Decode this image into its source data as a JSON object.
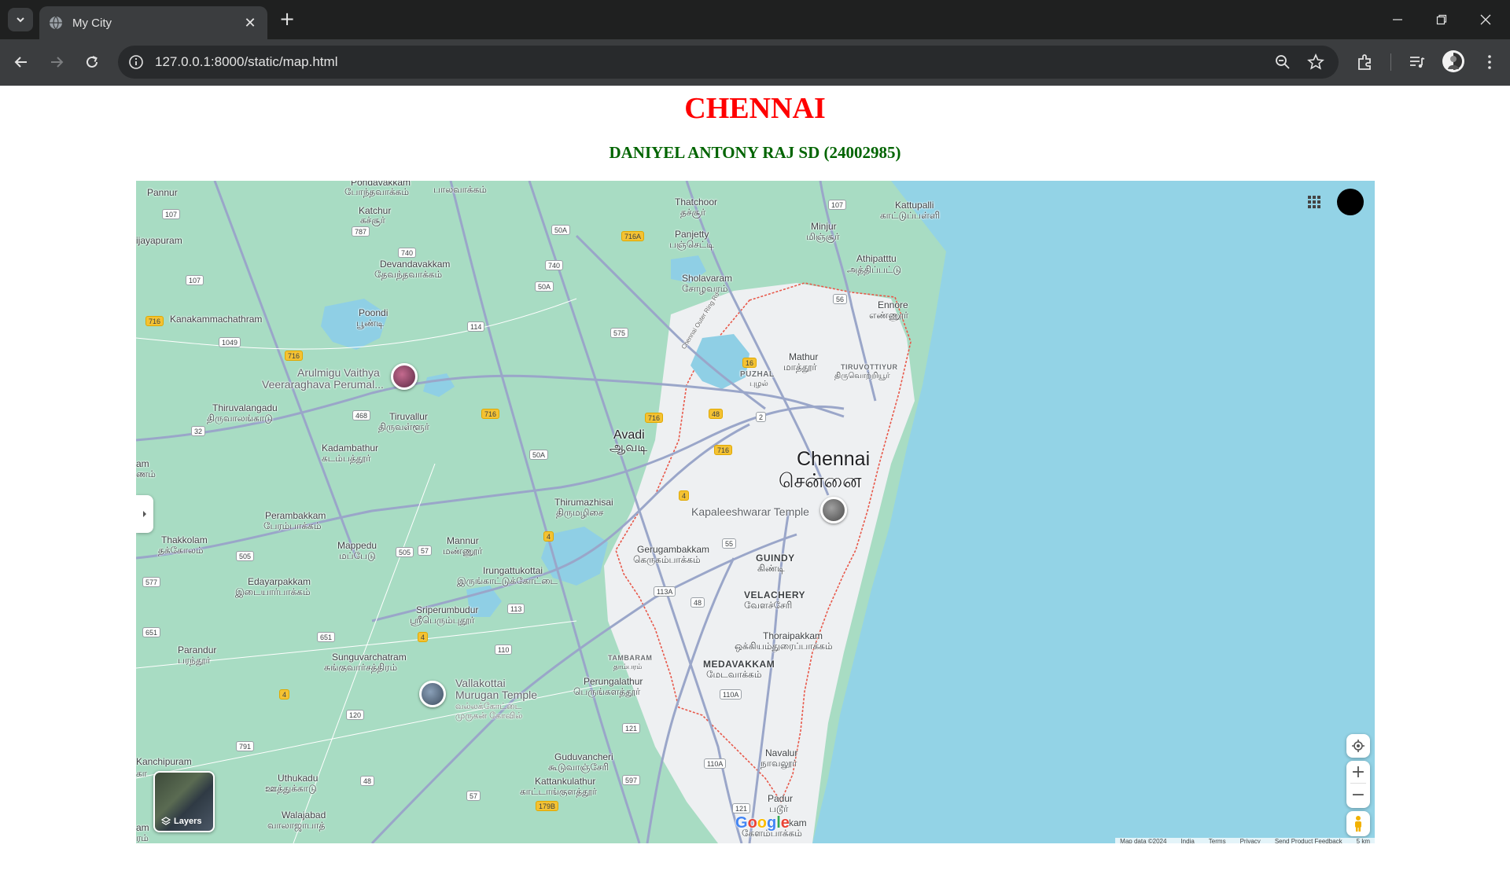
{
  "browser": {
    "tab_title": "My City",
    "url": "127.0.0.1:8000/static/map.html"
  },
  "page": {
    "title": "CHENNAI",
    "subtitle": "DANIYEL ANTONY RAJ SD (24002985)"
  },
  "map": {
    "labels": {
      "chennai": "Chennai",
      "chennai_ta": "சென்னை",
      "avadi": "Avadi",
      "avadi_ta": "ஆவடி",
      "kapaleeshwarar": "Kapaleeshwarar Temple",
      "arulmigu": "Arulmigu Vaithya",
      "veeraraghava": "Veeraraghava Perumal...",
      "valla_murugan": "Vallakottai",
      "valla_murugan2": "Murugan Temple",
      "valla_ta1": "வல்லக்கோட்டை",
      "valla_ta2": "முருகன் கோவில்",
      "pannur": "Pannur",
      "pondavakkam": "Pondavakkam",
      "pondavakkam_ta": "போந்தவாக்கம்",
      "paluvakkam_ta": "பாலவாக்கம்",
      "katchur": "Katchur",
      "katchur_ta": "கச்சூர்",
      "thatchoor": "Thatchoor",
      "thatchoor_ta": "தச்சூர்",
      "panjetty": "Panjetty",
      "panjetty_ta": "பஞ்செட்டி",
      "minjur": "Minjur",
      "minjur_ta": "மிஞ்சூர்",
      "kattupalli": "Kattupalli",
      "kattupalli_ta": "காட்டுப்பள்ளி",
      "vijayapuram": "ijayapuram",
      "devandavakkam": "Devandavakkam",
      "devandavakkam_ta": "தேவந்தவாக்கம்",
      "athipattu": "Athipatttu",
      "athipattu_ta": "அத்திப்பட்டு",
      "sholavaram": "Sholavaram",
      "sholavaram_ta": "சோழவரம்",
      "kanakammachathram": "Kanakammachathram",
      "poondi": "Poondi",
      "poondi_ta": "பூண்டி",
      "ennore": "Ennore",
      "ennore_ta": "எண்ணூர்",
      "mathur": "Mathur",
      "mathur_ta": "மாத்தூர்",
      "puzhal": "PUZHAL",
      "puzhal_ta": "புழல்",
      "tiruvottiyur": "TIRUVOTTIYUR",
      "tiruvottiyur_ta": "திருவொற்றியூர்",
      "thiruvalangadu": "Thiruvalangadu",
      "thiruvalangadu_ta": "திருவாலங்காடு",
      "tiruvallur": "Tiruvallur",
      "tiruvallur_ta": "திருவள்ளூர்",
      "kadambathur": "Kadambathur",
      "kadambathur_ta": "கடம்பத்தூர்",
      "thirumazhisai": "Thirumazhisai",
      "thirumazhisai_ta": "திருமழிசை",
      "perambakkam": "Perambakkam",
      "perambakkam_ta": "பேரம்பாக்கம்",
      "thakkolam": "Thakkolam",
      "thakkolam_ta": "தக்கோலம்",
      "mappedu": "Mappedu",
      "mappedu_ta": "மப்பேடு",
      "mannur": "Mannur",
      "mannur_ta": "மண்ணூர்",
      "gerugambakkam": "Gerugambakkam",
      "gerugambakkam_ta": "கெருகம்பாக்கம்",
      "guindy": "GUINDY",
      "guindy_ta": "கிண்டி",
      "irungattukottai": "Irungattukottai",
      "irungattukottai_ta": "இருங்காட்டுக்கோட்டை",
      "edayarpakkam": "Edayarpakkam",
      "edayarpakkam_ta": "இடையார்பாக்கம்",
      "velachery": "VELACHERY",
      "velachery_ta": "வேளச்சேரி",
      "sriperumbudur": "Sriperumbudur",
      "sriperumbudur_ta": "ஸ்ரீபெரும்புதூர்",
      "thoraipakkam": "Thoraipakkam",
      "thoraipakkam_ta": "ஒக்கியம்துரைப்பாக்கம்",
      "parandur": "Parandur",
      "parandur_ta": "பரந்தூர்",
      "sunguvarchatram": "Sunguvarchatram",
      "sunguvarchatram_ta": "சுங்குவார்சத்திரம்",
      "tambaram": "TAMBARAM",
      "tambaram_ta": "தாம்பரம்",
      "medavakkam": "MEDAVAKKAM",
      "medavakkam_ta": "மேடவாக்கம்",
      "perungalathur": "Perungalathur",
      "perungalathur_ta": "பெருங்களத்தூர்",
      "guduvancheri": "Guduvancheri",
      "guduvancheri_ta": "கூடுவாஞ்சேரி",
      "navalur": "Navalur",
      "navalur_ta": "நாவலூர்",
      "kanchipuram": "Kanchipuram",
      "uthukadu": "Uthukadu",
      "uthukadu_ta": "ஊத்துக்காடு",
      "kattankulathur": "Kattankulathur",
      "kattankulathur_ta": "காட்டாங்குளத்தூர்",
      "padur": "Padur",
      "padur_ta": "படூர்",
      "kelambakkam": "kam",
      "kelambakkam_ta": "கேளம்பாக்கம்",
      "walajabad": "Walajabad",
      "walajabad_ta": "வாலாஜாபாத்",
      "chennai_outer": "Chennai Outer Ring Rd",
      "left_am": "am",
      "left_nam": "ணம்",
      "left_ka": "கா",
      "left_am2": "am",
      "left_ram": "ரம்"
    },
    "shields": {
      "s107a": "107",
      "s107b": "107",
      "s787": "787",
      "s740a": "740",
      "s740b": "740",
      "s50a1": "50A",
      "s50a2": "50A",
      "s50a3": "50A",
      "s716a": "716A",
      "s56": "56",
      "s716": "716",
      "s1049": "1049",
      "s716b": "716",
      "s114": "114",
      "s575": "575",
      "s16": "16",
      "s468": "468",
      "s716c": "716",
      "s716d": "716",
      "s48": "48",
      "s2": "2",
      "s32": "32",
      "s716e": "716",
      "s4a": "4",
      "s4b": "4",
      "s55": "55",
      "s505": "505",
      "s505b": "505",
      "s57a": "57",
      "s577": "577",
      "s113a": "113A",
      "s48b": "48",
      "s113": "113",
      "s651": "651",
      "s651b": "651",
      "s4c": "4",
      "s110": "110",
      "s4d": "4",
      "s110a": "110A",
      "s120": "120",
      "s791": "791",
      "s121": "121",
      "s110a2": "110A",
      "s48c": "48",
      "s597": "597",
      "s57b": "57",
      "s179b": "179B",
      "s121b": "121"
    },
    "layers_label": "Layers",
    "google": [
      "G",
      "o",
      "o",
      "g",
      "l",
      "e"
    ],
    "google_colors": [
      "#4285F4",
      "#EA4335",
      "#FBBC05",
      "#4285F4",
      "#34A853",
      "#EA4335"
    ],
    "attribution": [
      "Map data ©2024",
      "India",
      "Terms",
      "Privacy",
      "Send Product Feedback",
      "5 km"
    ],
    "colors": {
      "land": "#a8dcc3",
      "urban": "#f1f3f4",
      "sea": "#93d3e6",
      "water": "#8fcfe5",
      "road": "#9aa6c9",
      "boundary": "#e8584a"
    }
  }
}
